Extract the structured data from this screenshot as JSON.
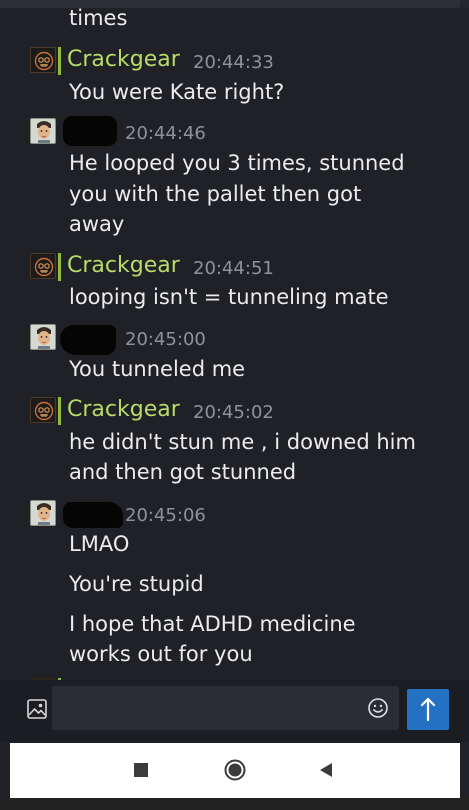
{
  "messages_top": {
    "partial_text": "times"
  },
  "messages": [
    {
      "user": "Crackgear",
      "time": "20:44:33",
      "lines": [
        "You were Kate right?"
      ]
    },
    {
      "user": "",
      "time": "20:44:46",
      "lines": [
        "He looped you 3 times, stunned",
        "you with the pallet then got",
        "away"
      ]
    },
    {
      "user": "Crackgear",
      "time": "20:44:51",
      "lines": [
        "looping isn't = tunneling mate"
      ]
    },
    {
      "user": "",
      "time": "20:45:00",
      "lines": [
        "You tunneled me"
      ]
    },
    {
      "user": "Crackgear",
      "time": "20:45:02",
      "lines": [
        "he didn't stun me , i downed him",
        "and then got stunned"
      ]
    },
    {
      "user": "",
      "time": "20:45:06",
      "lines": [
        "LMAO",
        "You're stupid",
        "I hope that ADHD medicine",
        "works out for you"
      ]
    }
  ],
  "composer": {
    "image_icon": "image-icon",
    "emoji_icon": "smiley-icon",
    "send_icon": "arrow-up-icon",
    "input_value": "",
    "send_color": "#2471c4"
  },
  "colors": {
    "background": "#1f2126",
    "username": "#b6dc6a",
    "timestamp": "#8e929a",
    "accent_bar": "#90ba3c"
  },
  "android_nav": {
    "icons": [
      "recents-square-icon",
      "home-circle-icon",
      "back-triangle-icon"
    ]
  }
}
